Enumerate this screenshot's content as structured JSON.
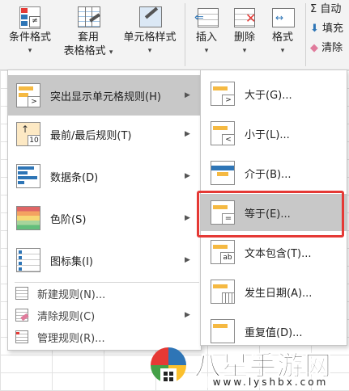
{
  "ribbon": {
    "conditional_format": "条件格式",
    "table_format_line1": "套用",
    "table_format_line2": "表格格式",
    "cell_style": "单元格样式",
    "insert": "插入",
    "delete": "删除",
    "format": "格式",
    "autosum": "自动",
    "fill": "填充",
    "clear": "清除"
  },
  "menu": {
    "items": [
      {
        "label": "突出显示单元格规则(H)",
        "active": true
      },
      {
        "label": "最前/最后规则(T)"
      },
      {
        "label": "数据条(D)"
      },
      {
        "label": "色阶(S)"
      },
      {
        "label": "图标集(I)"
      }
    ],
    "small_items": [
      {
        "label": "新建规则(N)..."
      },
      {
        "label": "清除规则(C)"
      },
      {
        "label": "管理规则(R)..."
      }
    ]
  },
  "submenu": {
    "items": [
      {
        "label": "大于(G)..."
      },
      {
        "label": "小于(L)..."
      },
      {
        "label": "介于(B)..."
      },
      {
        "label": "等于(E)...",
        "active": true
      },
      {
        "label": "文本包含(T)..."
      },
      {
        "label": "发生日期(A)..."
      },
      {
        "label": "重复值(D)..."
      }
    ]
  },
  "icons": {
    "10": "10",
    "ab": "ab"
  },
  "watermark": {
    "text": "八星手游网",
    "url": "www.lyshbx.com"
  },
  "colors": {
    "highlight": "#e53935",
    "accent_orange": "#f5b942",
    "accent_blue": "#2e75b6"
  }
}
